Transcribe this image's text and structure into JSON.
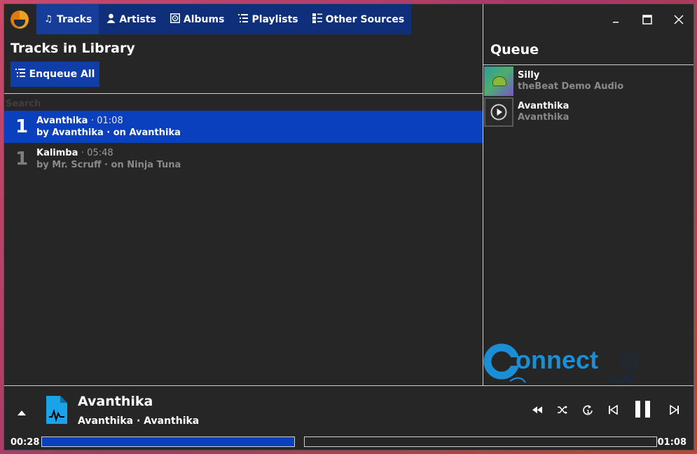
{
  "nav": {
    "tabs": [
      {
        "label": "Tracks",
        "icon": "music-note-icon",
        "active": true
      },
      {
        "label": "Artists",
        "icon": "person-icon",
        "active": false
      },
      {
        "label": "Albums",
        "icon": "album-icon",
        "active": false
      },
      {
        "label": "Playlists",
        "icon": "playlist-icon",
        "active": false
      },
      {
        "label": "Other Sources",
        "icon": "sources-icon",
        "active": false
      }
    ]
  },
  "library": {
    "title": "Tracks in Library",
    "enqueue_label": "Enqueue All",
    "search_placeholder": "Search",
    "tracks": [
      {
        "num": "1",
        "title": "Avanthika",
        "duration": "· 01:08",
        "by": "by Avanthika · on Avanthika",
        "selected": true
      },
      {
        "num": "1",
        "title": "Kalimba",
        "duration": "· 05:48",
        "by": "by Mr. Scruff · on Ninja Tuna",
        "selected": false
      }
    ]
  },
  "queue": {
    "title": "Queue",
    "items": [
      {
        "title": "Silly",
        "subtitle": "theBeat Demo Audio",
        "thumb": "album-art"
      },
      {
        "title": "Avanthika",
        "subtitle": "Avanthika",
        "thumb": "play-icon"
      }
    ]
  },
  "watermark": {
    "text_main": "onnect",
    "text_sub": "com"
  },
  "player": {
    "title": "Avanthika",
    "subtitle": "Avanthika · Avanthika",
    "elapsed": "00:28",
    "total": "01:08",
    "progress": 0.41
  },
  "colors": {
    "accent": "#0a3fbd",
    "tab_bar": "#0f2f7a",
    "background": "#262626",
    "file_icon": "#1aa3e8"
  }
}
